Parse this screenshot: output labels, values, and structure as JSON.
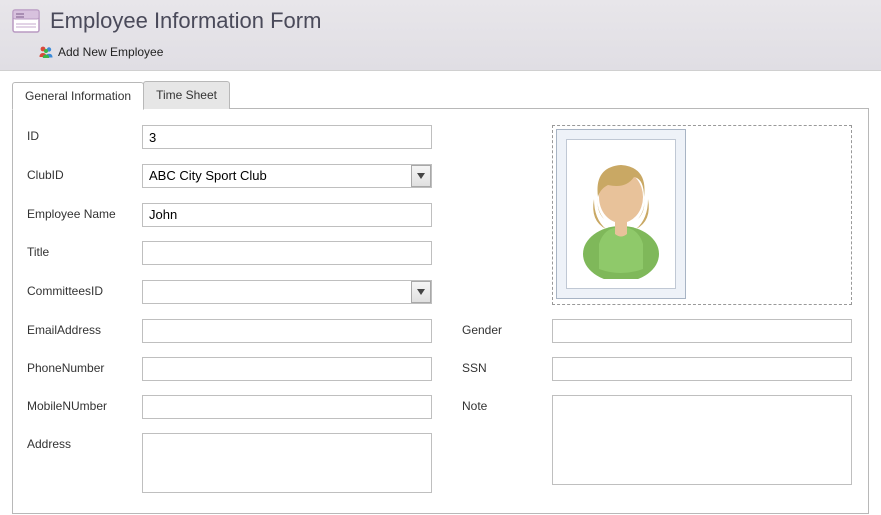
{
  "header": {
    "title": "Employee Information Form",
    "addEmployee": "Add New Employee"
  },
  "tabs": {
    "general": "General Information",
    "timesheet": "Time Sheet"
  },
  "labels": {
    "id": "ID",
    "clubId": "ClubID",
    "employeeName": "Employee Name",
    "title": "Title",
    "committeesId": "CommitteesID",
    "emailAddress": "EmailAddress",
    "phoneNumber": "PhoneNumber",
    "mobileNumber": "MobileNUmber",
    "address": "Address",
    "gender": "Gender",
    "ssn": "SSN",
    "note": "Note"
  },
  "values": {
    "id": "3",
    "clubId": "ABC City Sport Club",
    "employeeName": "John",
    "title": "",
    "committeesId": "",
    "emailAddress": "",
    "phoneNumber": "",
    "mobileNumber": "",
    "address": "",
    "gender": "",
    "ssn": "",
    "note": ""
  }
}
